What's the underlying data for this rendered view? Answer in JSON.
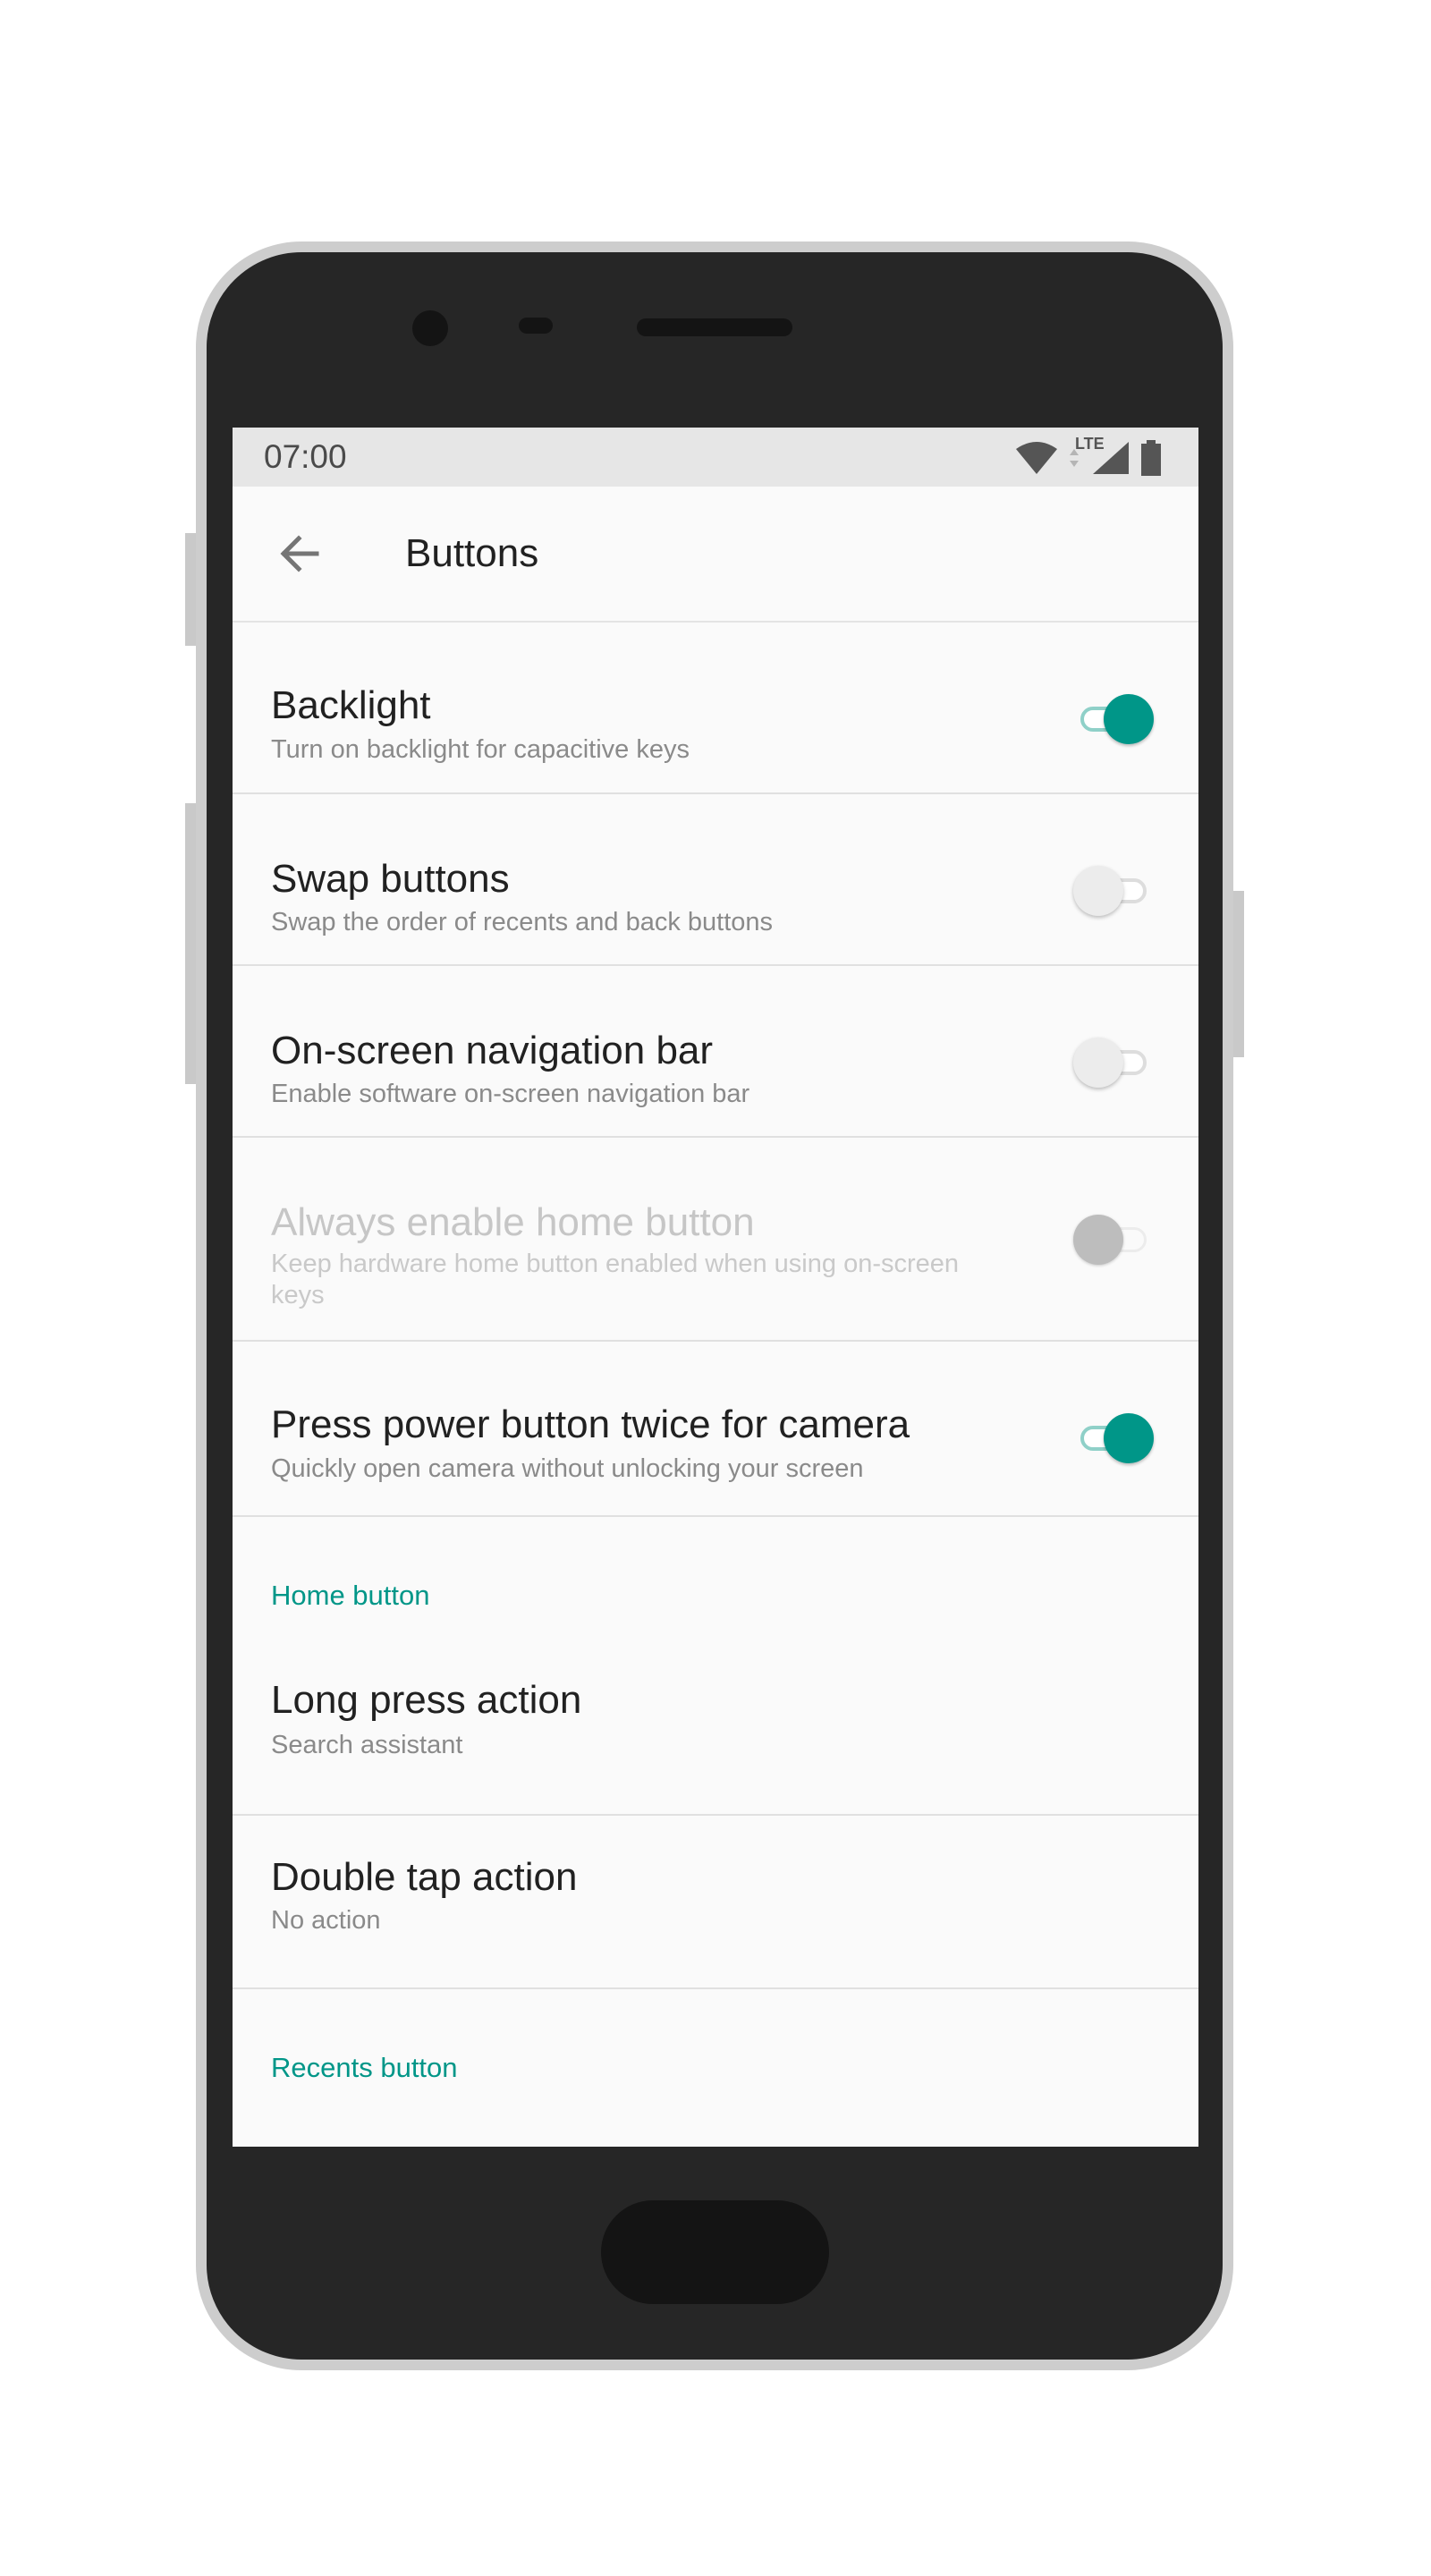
{
  "status_bar": {
    "time": "07:00",
    "network_label": "LTE",
    "icons": [
      "wifi-icon",
      "data-arrows-icon",
      "cell-signal-icon",
      "battery-icon"
    ]
  },
  "app_bar": {
    "title": "Buttons",
    "back_icon": "arrow-left-icon"
  },
  "settings": [
    {
      "title": "Backlight",
      "subtitle": "Turn on backlight for capacitive keys",
      "toggle": "on",
      "enabled": true
    },
    {
      "title": "Swap buttons",
      "subtitle": "Swap the order of recents and back buttons",
      "toggle": "off",
      "enabled": true
    },
    {
      "title": "On-screen navigation bar",
      "subtitle": "Enable software on-screen navigation bar",
      "toggle": "off",
      "enabled": true
    },
    {
      "title": "Always enable home button",
      "subtitle": "Keep hardware home button enabled when using on-screen keys",
      "toggle": "off",
      "enabled": false
    },
    {
      "title": "Press power button twice for camera",
      "subtitle": "Quickly open camera without unlocking your screen",
      "toggle": "on",
      "enabled": true
    }
  ],
  "home_button_section": {
    "header": "Home button",
    "items": [
      {
        "title": "Long press action",
        "value": "Search assistant"
      },
      {
        "title": "Double tap action",
        "value": "No action"
      }
    ]
  },
  "recents_button_section": {
    "header": "Recents button"
  },
  "colors": {
    "accent": "#009688",
    "toggle_track_on": "#8fd0c8",
    "screen_background": "#fafafa",
    "phone_body": "#262626",
    "status_bar": "#e6e6e6"
  }
}
